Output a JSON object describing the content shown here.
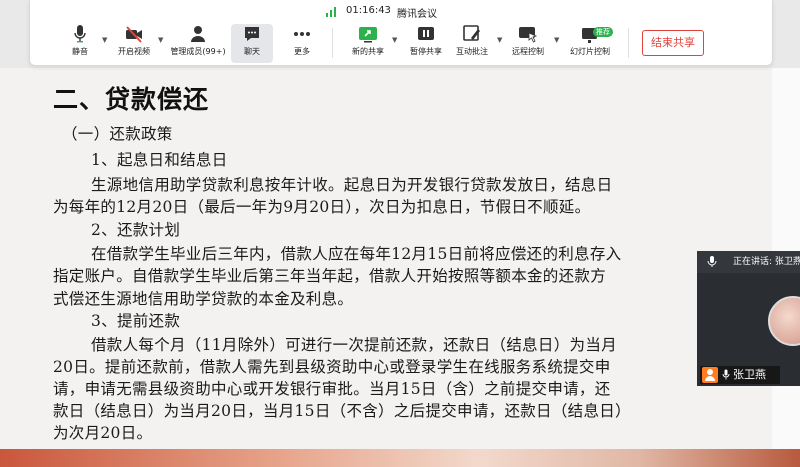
{
  "meeting": {
    "time": "01:16:43",
    "app_name": "腾讯会议"
  },
  "toolbar": {
    "mute_label": "静音",
    "video_label": "开启视频",
    "members_label": "管理成员(99+)",
    "chat_label": "聊天",
    "more_label": "更多",
    "new_share_label": "新的共享",
    "pause_share_label": "暂停共享",
    "annotate_label": "互动批注",
    "remote_label": "远程控制",
    "slides_label": "幻灯片控制",
    "slides_badge": "推荐",
    "end_share_label": "结束共享",
    "accent_green": "#2bb24c",
    "end_red": "#e0443b"
  },
  "slide": {
    "title": "二、贷款偿还",
    "lines": [
      "（一）还款政策",
      "1、起息日和结息日",
      "生源地信用助学贷款利息按年计收。起息日为开发银行贷款发放日，结息日",
      "为每年的12月20日（最后一年为9月20日），次日为扣息日，节假日不顺延。",
      "2、还款计划",
      "在借款学生毕业后三年内，借款人应在每年12月15日前将应偿还的利息存入",
      "指定账户。自借款学生毕业后第三年当年起，借款人开始按照等额本金的还款方",
      "式偿还生源地信用助学贷款的本金及利息。",
      "3、提前还款",
      "借款人每个月（11月除外）可进行一次提前还款，还款日（结息日）为当月",
      "20日。提前还款前，借款人需先到县级资助中心或登录学生在线服务系统提交申",
      "请，申请无需县级资助中心或开发银行审批。当月15日（含）之前提交申请，还",
      "款日（结息日）为当月20日，当月15日（不含）之后提交申请，还款日（结息日）",
      "为次月20日。"
    ]
  },
  "speaker": {
    "speaking_text": "正在讲话: 张卫燕",
    "name": "张卫燕"
  }
}
